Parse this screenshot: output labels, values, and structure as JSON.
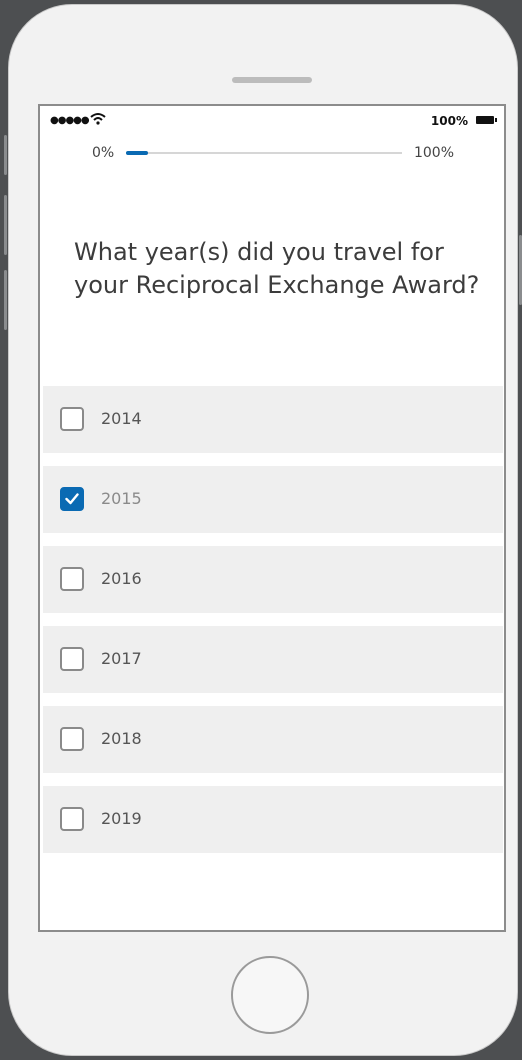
{
  "status_bar": {
    "signal": "●●●●●",
    "battery": "100%"
  },
  "progress": {
    "min_label": "0%",
    "max_label": "100%",
    "value": 0.08,
    "color": "#0a6ab3"
  },
  "question": "What year(s) did you travel for your Reciprocal Exchange Award?",
  "options": [
    {
      "label": "2014",
      "checked": false
    },
    {
      "label": "2015",
      "checked": true
    },
    {
      "label": "2016",
      "checked": false
    },
    {
      "label": "2017",
      "checked": false
    },
    {
      "label": "2018",
      "checked": false
    },
    {
      "label": "2019",
      "checked": false
    }
  ],
  "colors": {
    "accent": "#0a6ab3",
    "option_bg": "#efefef"
  }
}
